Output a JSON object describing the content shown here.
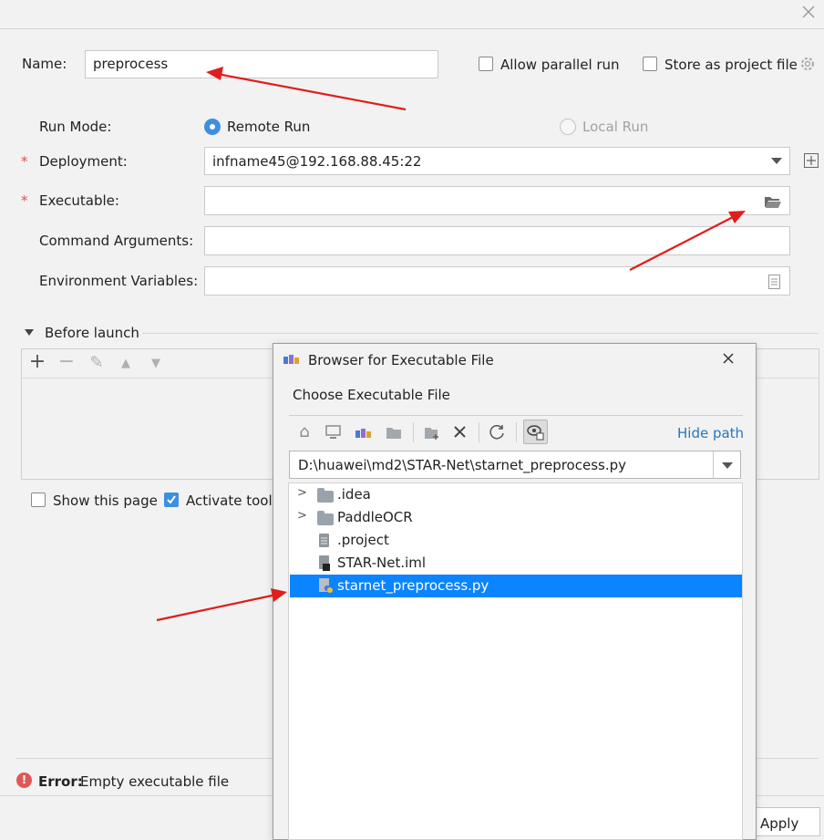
{
  "config": {
    "name_label": "Name:",
    "name_value": "preprocess",
    "allow_parallel_label": "Allow parallel run",
    "store_project_label": "Store as project file",
    "run_mode_label": "Run Mode:",
    "remote_run_label": "Remote Run",
    "local_run_label": "Local Run",
    "deployment_label": "Deployment:",
    "deployment_value": "infname45@192.168.88.45:22",
    "executable_label": "Executable:",
    "executable_value": "",
    "command_args_label": "Command Arguments:",
    "env_vars_label": "Environment Variables:",
    "required_mark": "*",
    "before_launch_label": "Before launch",
    "show_page_label": "Show this page",
    "activate_tool_label": "Activate tool",
    "error_prefix": "Error:",
    "error_message": "Empty executable file",
    "apply_label": "Apply"
  },
  "dialog": {
    "title": "Browser for Executable File",
    "subtitle": "Choose Executable File",
    "hide_path_label": "Hide path",
    "path_value": "D:\\huawei\\md2\\STAR-Net\\starnet_preprocess.py",
    "tree": [
      {
        "name": ".idea",
        "kind": "folder",
        "expandable": true,
        "selected": false
      },
      {
        "name": "PaddleOCR",
        "kind": "folder",
        "expandable": true,
        "selected": false
      },
      {
        "name": ".project",
        "kind": "file",
        "expandable": false,
        "selected": false
      },
      {
        "name": "STAR-Net.iml",
        "kind": "iml",
        "expandable": false,
        "selected": false
      },
      {
        "name": "starnet_preprocess.py",
        "kind": "python",
        "expandable": false,
        "selected": true
      }
    ]
  },
  "colors": {
    "accent": "#3d8fe0",
    "selection": "#0a84ff",
    "error": "#e05757",
    "arrow": "#e01d1d",
    "link": "#2675bf"
  },
  "icons": [
    "close-icon",
    "gear-icon",
    "chevron-down-icon",
    "add-icon",
    "folder-open-icon",
    "list-icon",
    "plus-icon",
    "minus-icon",
    "pencil-icon",
    "arrow-up-icon",
    "arrow-down-icon",
    "home-icon",
    "desktop-icon",
    "project-icon",
    "module-icon",
    "new-folder-icon",
    "delete-icon",
    "refresh-icon",
    "show-hidden-icon",
    "error-icon",
    "folder-icon",
    "file-icon",
    "python-file-icon"
  ]
}
